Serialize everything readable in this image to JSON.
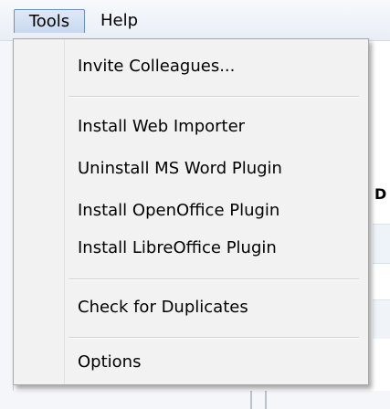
{
  "menubar": {
    "items": [
      {
        "label": "Tools",
        "active": true
      },
      {
        "label": "Help",
        "active": false
      }
    ]
  },
  "background": {
    "right_fragment": "D"
  },
  "tools_menu": {
    "items": [
      {
        "label": "Invite Colleagues..."
      },
      {
        "label": "Install Web Importer"
      },
      {
        "label": "Uninstall MS Word Plugin"
      },
      {
        "label": "Install OpenOffice Plugin"
      },
      {
        "label": "Install LibreOffice Plugin"
      },
      {
        "label": "Check for Duplicates"
      },
      {
        "label": "Options"
      }
    ]
  },
  "colors": {
    "active_border": "#6f8fbd",
    "menu_background": "#f2f2f2"
  }
}
